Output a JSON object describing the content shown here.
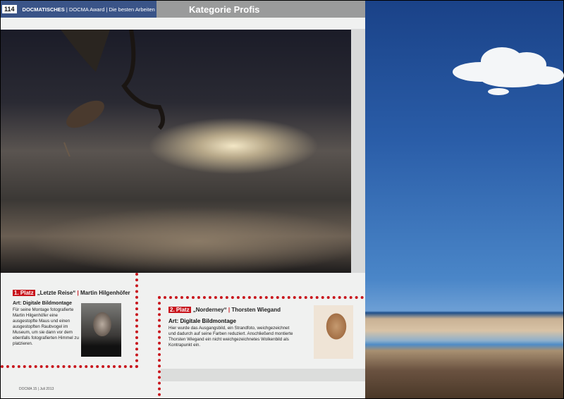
{
  "header": {
    "page_number": "114",
    "section": "DOCMATISCHES",
    "section_sub": "| DOCMA Award | Die besten Arbeiten",
    "title": "Kategorie Profis"
  },
  "entries": [
    {
      "place": "1. Platz",
      "work": "„Letzte Reise“",
      "separator": "|",
      "author": "Martin Hilgenhöfer",
      "art": "Art: Digitale Bildmontage",
      "text": "Für seine Montage fotografierte Martin Hilgenhöfer eine ausgestopfte Maus und einen ausgestopften Raubvogel im Museum, um sie dann vor dem ebenfalls fotografierten Himmel zu platzieren."
    },
    {
      "place": "2. Platz",
      "work": "„Norderney“",
      "separator": "|",
      "author": "Thorsten Wiegand",
      "art": "Art: Digitale Bildmontage",
      "text": "Hier wurde das Ausgangsbild, ein Strandfoto, weichgezeichnet und dadurch auf seine Farben reduziert. Anschließend montierte Thorsten Wiegand ein nicht weichgezeichnetes Wolkenbild als Kontrapunkt ein."
    }
  ],
  "footer": "DOCMA 15 | Juli 2013",
  "colors": {
    "accent": "#c8161d",
    "header_blue": "#3a5488",
    "header_gray": "#9a9b9b"
  }
}
